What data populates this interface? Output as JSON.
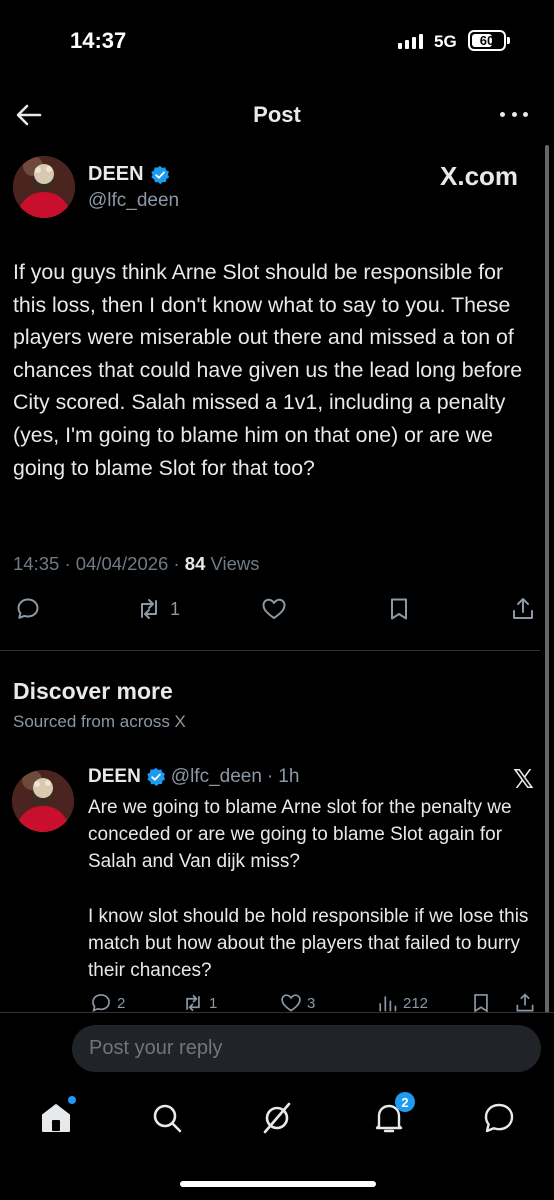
{
  "status_bar": {
    "time": "14:37",
    "network": "5G",
    "battery": "60"
  },
  "header": {
    "title": "Post"
  },
  "post": {
    "author_name": "DEEN",
    "author_handle": "@lfc_deen",
    "source_label": "X.com",
    "text": "If you guys think Arne Slot should be responsible for this loss, then I don't know what to say to you. These players were miserable out there and missed a ton of chances that could have given us the lead long before City scored. Salah missed a 1v1, including a penalty (yes, I'm going to blame him on that one) or are we going to blame Slot for that too?",
    "time": "14:35",
    "date": "04/04/2026",
    "views_count": "84",
    "views_label": "Views",
    "reposts": "1"
  },
  "discover": {
    "title": "Discover more",
    "subtitle": "Sourced from across X",
    "item": {
      "author_name": "DEEN",
      "author_handle": "@lfc_deen",
      "age": "1h",
      "text": "Are we going to blame Arne slot for the penalty we conceded or are we going to blame Slot again for Salah and Van dijk miss?\n\nI know slot should be hold responsible if we lose this match but how about the players that failed to burry their chances?",
      "replies": "2",
      "reposts": "1",
      "likes": "3",
      "views": "212"
    }
  },
  "reply": {
    "placeholder": "Post your reply"
  },
  "nav": {
    "notification_count": "2"
  },
  "colors": {
    "accent": "#1d9bf0",
    "background": "#000000",
    "secondary_text": "#8b98a5",
    "avatar_kit": "#c8102e"
  }
}
